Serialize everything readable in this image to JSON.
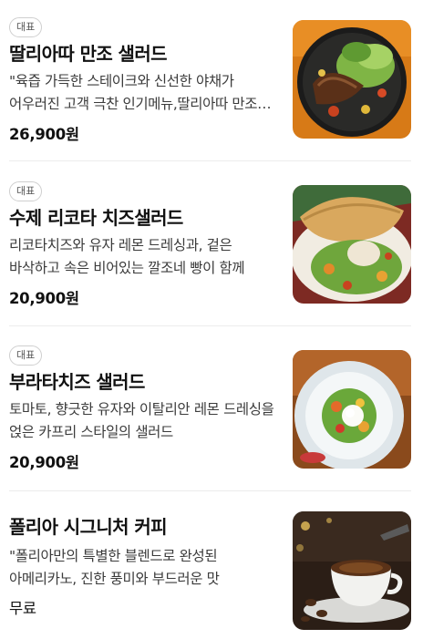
{
  "menu": {
    "items": [
      {
        "badge": "대표",
        "name": "딸리아따 만조 샐러드",
        "description": "\"육즙 가득한 스테이크와 신선한 야채가 어우러진 고객 극찬 인기메뉴,딸리아따 만조 샐러드",
        "price": "26,900원",
        "image_icon": "steak-salad-photo"
      },
      {
        "badge": "대표",
        "name": "수제 리코타 치즈샐러드",
        "description": "리코타치즈와 유자 레몬 드레싱과, 겉은 바삭하고 속은 비어있는 깔조네 빵이 함께",
        "price": "20,900원",
        "image_icon": "ricotta-salad-photo"
      },
      {
        "badge": "대표",
        "name": "부라타치즈 샐러드",
        "description": "토마토, 향긋한 유자와 이탈리안 레몬 드레싱을 얹은 카프리 스타일의 샐러드",
        "price": "20,900원",
        "image_icon": "burrata-salad-photo"
      },
      {
        "name": "폴리아 시그니처 커피",
        "description": "\"폴리아만의 특별한 블렌드로 완성된 아메리카노, 진한 풍미와 부드러운 맛",
        "price": "무료",
        "image_icon": "coffee-cup-photo"
      }
    ]
  }
}
